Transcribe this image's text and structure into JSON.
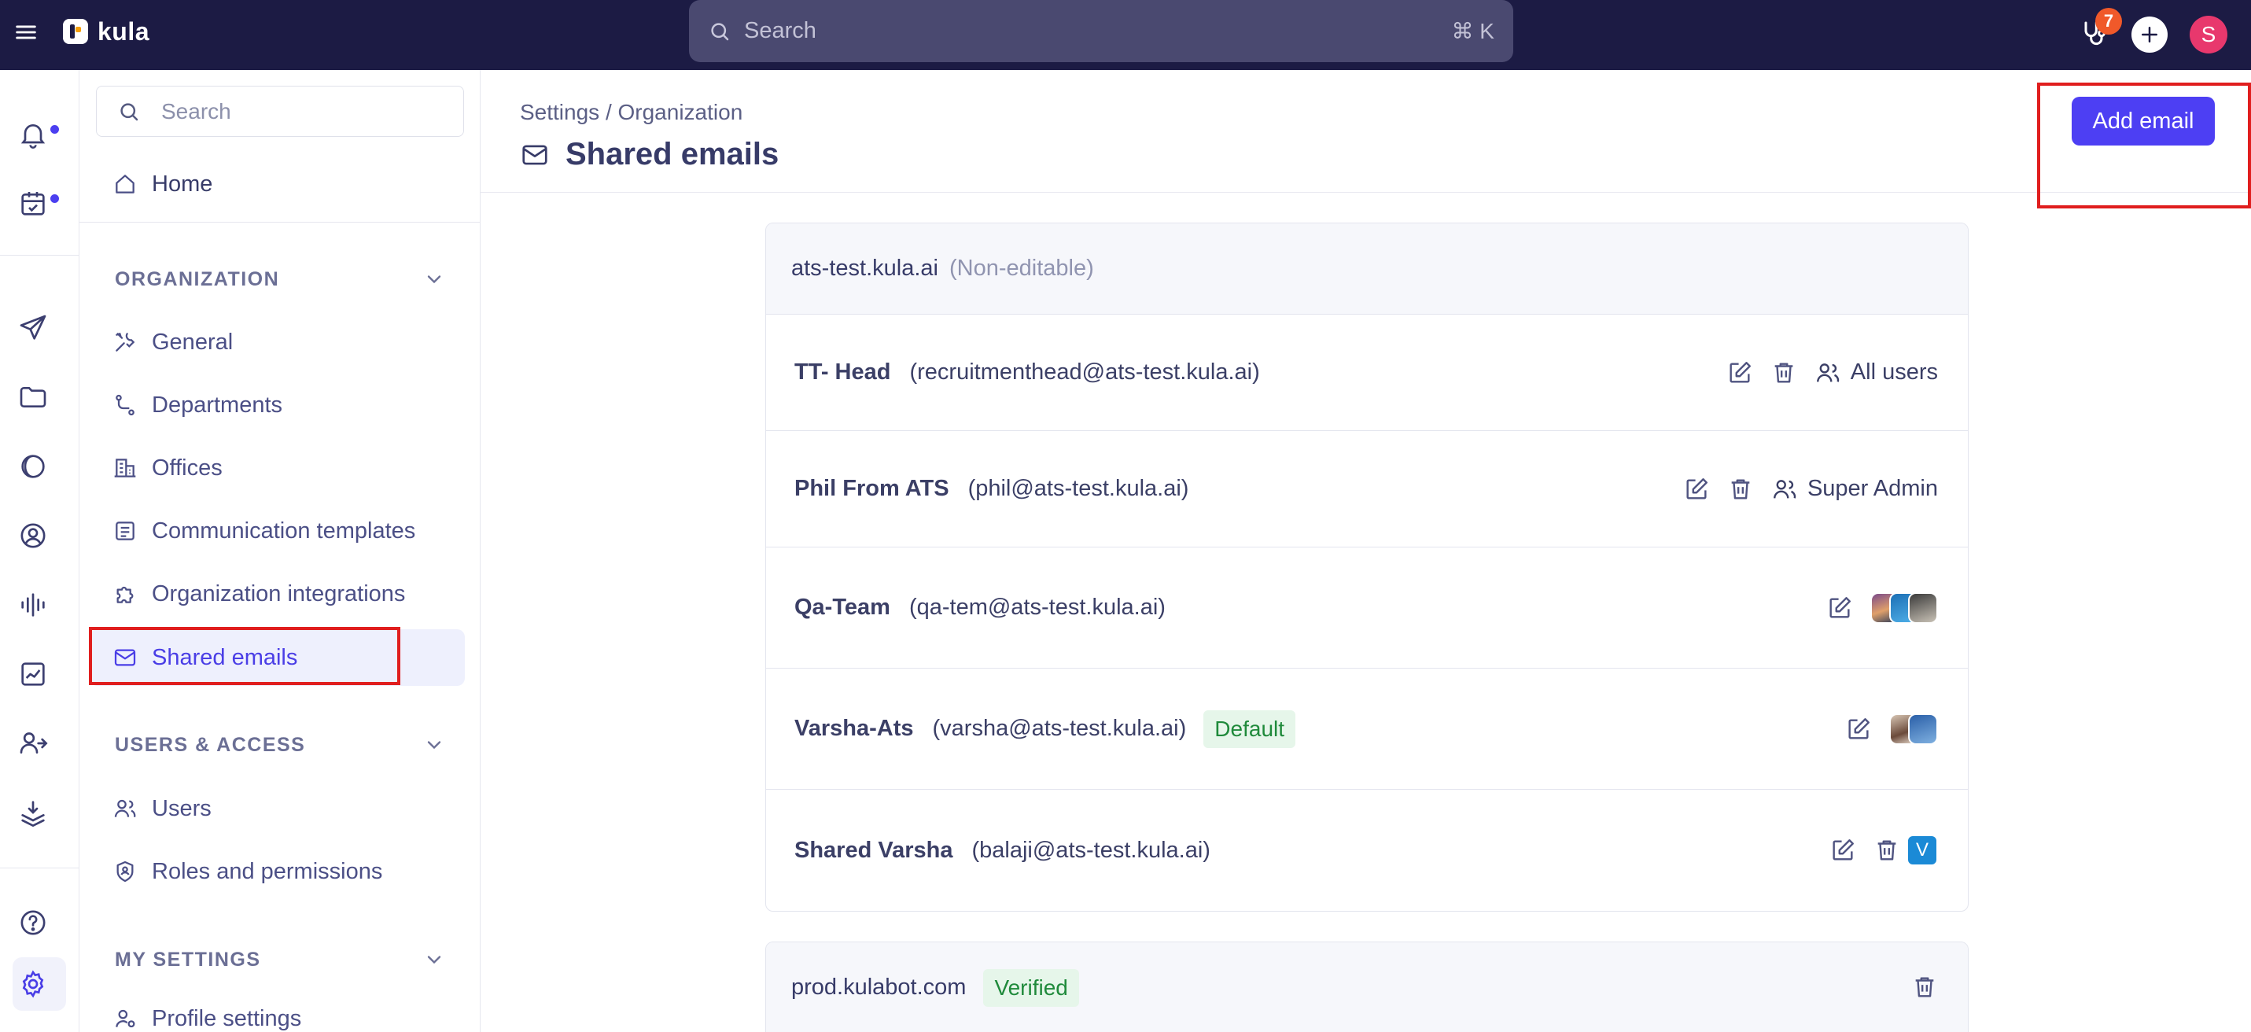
{
  "topbar": {
    "brand": "kula",
    "search_placeholder": "Search",
    "search_shortcut": "⌘ K",
    "notification_count": "7",
    "avatar_initial": "S"
  },
  "sidebar": {
    "search_placeholder": "Search",
    "home": "Home",
    "sections": [
      {
        "title": "ORGANIZATION",
        "items": [
          "General",
          "Departments",
          "Offices",
          "Communication templates",
          "Organization integrations",
          "Shared emails"
        ]
      },
      {
        "title": "USERS & ACCESS",
        "items": [
          "Users",
          "Roles and permissions"
        ]
      },
      {
        "title": "MY SETTINGS",
        "items": [
          "Profile settings"
        ]
      }
    ],
    "active_item": "Shared emails"
  },
  "main": {
    "breadcrumb": "Settings / Organization",
    "title": "Shared emails",
    "add_button": "Add email",
    "groups": [
      {
        "domain": "ats-test.kula.ai",
        "note": "(Non-editable)",
        "emails": [
          {
            "name": "TT- Head",
            "address": "(recruitmenthead@ats-test.kula.ai)",
            "access": "All users"
          },
          {
            "name": "Phil From ATS",
            "address": "(phil@ats-test.kula.ai)",
            "access": "Super Admin"
          },
          {
            "name": "Qa-Team",
            "address": "(qa-tem@ats-test.kula.ai)"
          },
          {
            "name": "Varsha-Ats",
            "address": "(varsha@ats-test.kula.ai)",
            "tag": "Default"
          },
          {
            "name": "Shared Varsha",
            "address": "(balaji@ats-test.kula.ai)",
            "avatar_initial": "V"
          }
        ]
      },
      {
        "domain": "prod.kulabot.com",
        "tag": "Verified"
      }
    ]
  },
  "colors": {
    "topbar": "#1c1b44",
    "accent": "#4d3ff3",
    "highlight_box": "#e01e1e",
    "success_bg": "#e6f6ea",
    "success_text": "#1f8a3b"
  }
}
